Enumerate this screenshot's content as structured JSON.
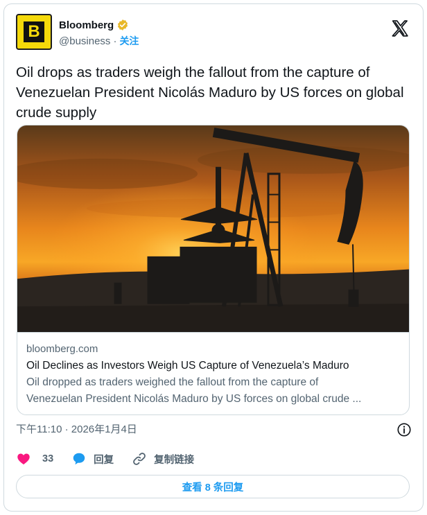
{
  "author": {
    "display_name": "Bloomberg",
    "handle": "@business",
    "separator": "·",
    "follow_label": "关注",
    "avatar_letter": "B",
    "verified_badge": "gold-verified-icon"
  },
  "tweet": {
    "text": "Oil drops as traders weigh the fallout from the capture of Venezuelan President Nicolás Maduro by US forces on global crude supply",
    "timestamp": "下午11:10 · 2026年1月4日"
  },
  "card": {
    "image": "oil-pumpjack-sunset-image",
    "domain": "bloomberg.com",
    "title": "Oil Declines as Investors Weigh US Capture of Venezuela’s Maduro",
    "description_line1": "Oil dropped as traders weighed the fallout from the capture of",
    "description_line2": "Venezuelan President Nicolás Maduro by US forces on global crude ..."
  },
  "actions": {
    "like_count": "33",
    "reply_label": "回复",
    "copy_link_label": "复制链接"
  },
  "replies_button_label": "查看 8 条回复",
  "colors": {
    "accent": "#1d9bf0",
    "like": "#f91880",
    "text_primary": "#0f1419",
    "text_secondary": "#536471",
    "border": "#cfd9de",
    "avatar_yellow": "#f5d90a"
  }
}
